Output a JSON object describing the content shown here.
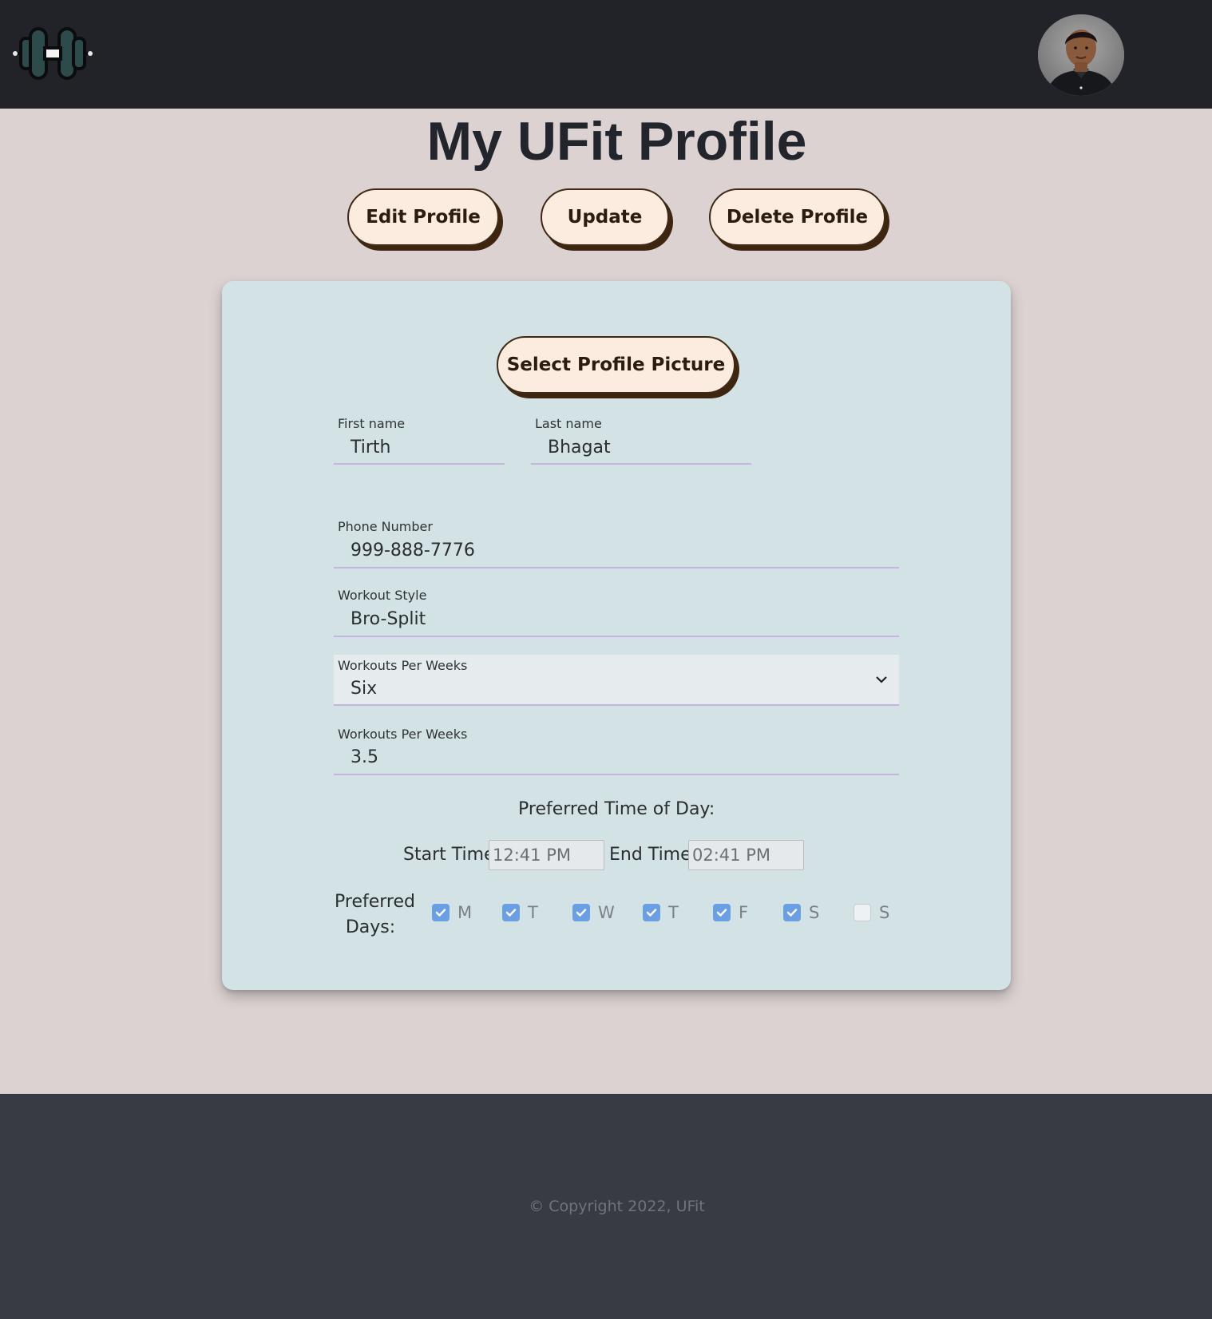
{
  "header": {
    "logo_icon": "dumbbell-icon",
    "avatar_icon": "user-avatar"
  },
  "page": {
    "title": "My UFit Profile"
  },
  "actions": {
    "edit_label": "Edit Profile",
    "update_label": "Update",
    "delete_label": "Delete Profile"
  },
  "form": {
    "select_picture_label": "Select Profile Picture",
    "first_name": {
      "label": "First name",
      "value": "Tirth"
    },
    "last_name": {
      "label": "Last name",
      "value": "Bhagat"
    },
    "phone": {
      "label": "Phone Number",
      "value": "999-888-7776"
    },
    "workout_style": {
      "label": "Workout Style",
      "value": "Bro-Split"
    },
    "workouts_per_week": {
      "label": "Workouts Per Weeks",
      "value": "Six"
    },
    "workouts_hours": {
      "label": "Workouts Per Weeks",
      "value": "3.5"
    },
    "time_heading": "Preferred Time of Day:",
    "start_label": "Start Time:",
    "start_value": "12:41  PM",
    "end_label": "End Time:",
    "end_value": "02:41  PM",
    "days_label_line1": "Preferred",
    "days_label_line2": "Days:",
    "days": [
      {
        "letter": "M",
        "checked": true
      },
      {
        "letter": "T",
        "checked": true
      },
      {
        "letter": "W",
        "checked": true
      },
      {
        "letter": "T",
        "checked": true
      },
      {
        "letter": "F",
        "checked": true
      },
      {
        "letter": "S",
        "checked": true
      },
      {
        "letter": "S",
        "checked": false
      }
    ]
  },
  "footer": {
    "copyright": "© Copyright 2022, UFit"
  },
  "colors": {
    "background": "#dcd2d2",
    "topbar": "#212328",
    "card": "#d3e2e4",
    "button": "#fcebdf",
    "checkbox": "#6a9fe4",
    "footer": "#383b44"
  }
}
